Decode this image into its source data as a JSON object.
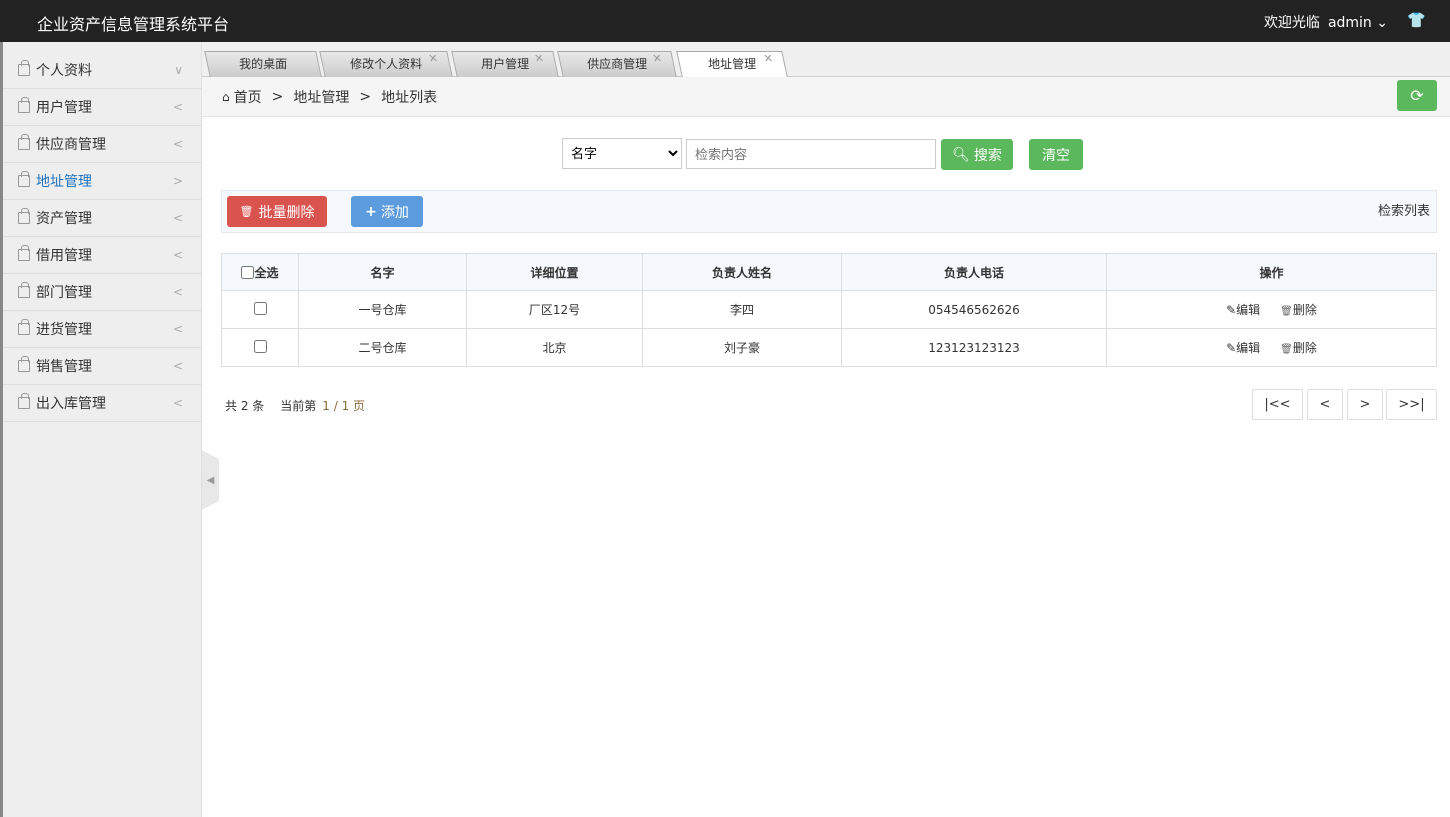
{
  "header": {
    "title": "企业资产信息管理系统平台",
    "welcome": "欢迎光临",
    "user": "admin"
  },
  "sidebar": {
    "items": [
      {
        "label": "个人资料",
        "arrow": "∨"
      },
      {
        "label": "用户管理",
        "arrow": "<"
      },
      {
        "label": "供应商管理",
        "arrow": "<"
      },
      {
        "label": "地址管理",
        "arrow": ">"
      },
      {
        "label": "资产管理",
        "arrow": "<"
      },
      {
        "label": "借用管理",
        "arrow": "<"
      },
      {
        "label": "部门管理",
        "arrow": "<"
      },
      {
        "label": "进货管理",
        "arrow": "<"
      },
      {
        "label": "销售管理",
        "arrow": "<"
      },
      {
        "label": "出入库管理",
        "arrow": "<"
      }
    ]
  },
  "tabs": [
    {
      "label": "我的桌面"
    },
    {
      "label": "修改个人资料"
    },
    {
      "label": "用户管理"
    },
    {
      "label": "供应商管理"
    },
    {
      "label": "地址管理"
    }
  ],
  "breadcrumb": {
    "home": "首页",
    "section": "地址管理",
    "page": "地址列表"
  },
  "search": {
    "field": "名字",
    "placeholder": "检索内容",
    "search_label": "搜索",
    "clear_label": "清空"
  },
  "toolbar": {
    "batch_delete": "批量删除",
    "add": "添加",
    "list_label": "检索列表"
  },
  "table": {
    "select_all": "全选",
    "headers": [
      "名字",
      "详细位置",
      "负责人姓名",
      "负责人电话",
      "操作"
    ],
    "rows": [
      [
        "一号仓库",
        "厂区12号",
        "李四",
        "054546562626"
      ],
      [
        "二号仓库",
        "北京",
        "刘子豪",
        "123123123123"
      ]
    ],
    "edit": "编辑",
    "delete": "删除"
  },
  "pagination": {
    "total": "共 2 条",
    "current_label": "当前第",
    "current": "1 / 1 页",
    "first": "|<<",
    "prev": "<",
    "next": ">",
    "last": ">>|"
  },
  "colors": {
    "green": "#5cb85c",
    "red": "#d9534f",
    "blue": "#5b9bde"
  }
}
